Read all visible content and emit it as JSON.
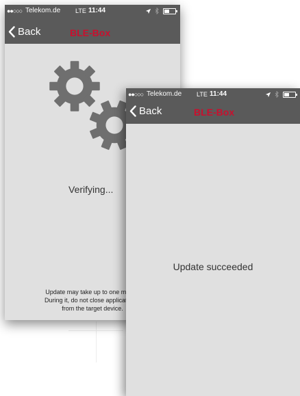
{
  "screen_back": {
    "status_bar": {
      "signal": "●●○○○",
      "carrier": "Telekom.de",
      "network": "LTE",
      "time": "11:44"
    },
    "nav": {
      "back_label": "Back",
      "title": "BLE-Box"
    },
    "status_text": "Verifying...",
    "hint_lines": [
      "Update may take up to one minute",
      "During it, do not close application o",
      "from the target device."
    ]
  },
  "screen_front": {
    "status_bar": {
      "signal": "●●○○○",
      "carrier": "Telekom.de",
      "network": "LTE",
      "time": "11:44"
    },
    "nav": {
      "back_label": "Back",
      "title": "BLE-Box"
    },
    "status_text": "Update succeeded"
  },
  "colors": {
    "header_bg": "#5a5a5a",
    "title_red": "#c8102e",
    "screen_bg": "#e0e0e0",
    "gear_gray": "#6f6f6f"
  },
  "icons": [
    "back-chevron-icon",
    "location-arrow-icon",
    "bluetooth-icon",
    "battery-icon",
    "gear-icon"
  ]
}
